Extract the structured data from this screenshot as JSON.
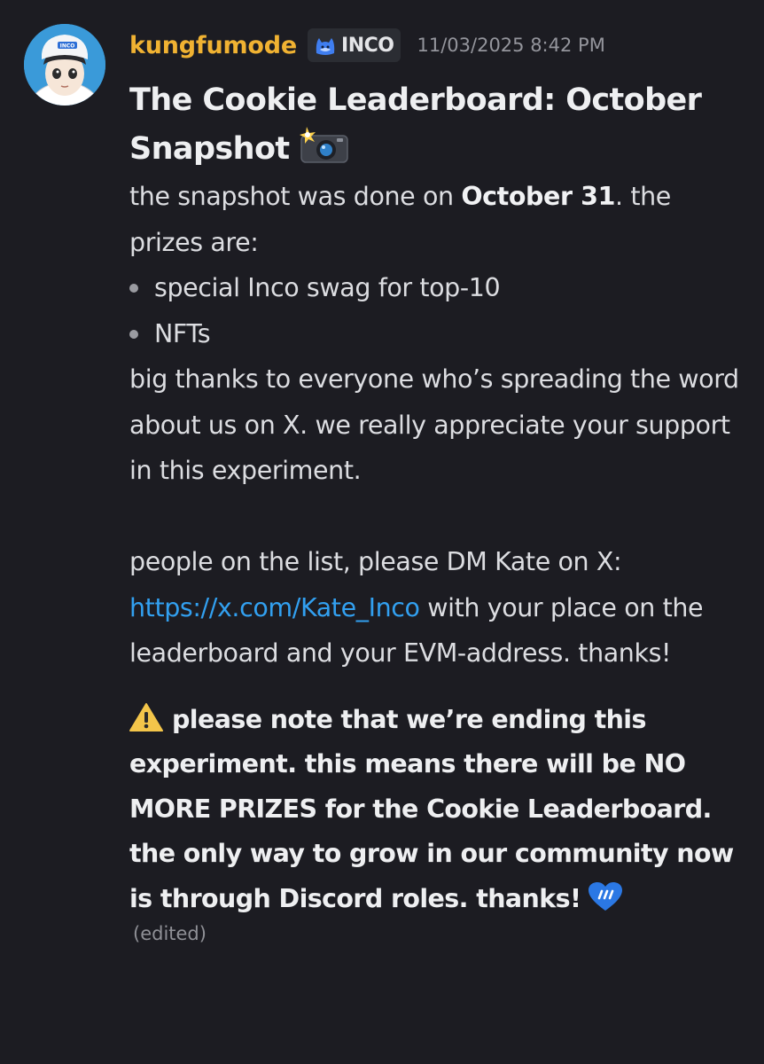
{
  "message": {
    "author": "kungfumode",
    "author_color": "#f0b232",
    "avatar_cap_text": "INCO",
    "server_tag": {
      "icon": "inco-cat-icon",
      "label": "INCO"
    },
    "timestamp": "11/03/2025 8:42 PM",
    "title": "The Cookie Leaderboard: October Snapshot",
    "title_emoji": "camera-with-flash-icon",
    "intro_pre": "the snapshot was done on ",
    "intro_bold": "October 31",
    "intro_post": ". the prizes are:",
    "prizes": [
      "special Inco swag for top-10",
      "NFTs"
    ],
    "thanks_paragraph": "big thanks to everyone who’s spreading the word about us on X. we really appreciate your support in this experiment.",
    "dm_pre": "people on the list, please DM Kate on X: ",
    "dm_link": "https://x.com/Kate_Inco",
    "dm_post": " with your place on the leaderboard and your EVM-address. thanks!",
    "link_color": "#32a0f0",
    "warning_icon": "warning-icon",
    "warning_text": "please note that we’re ending this experiment. this means there will be NO MORE PRIZES for the Cookie Leaderboard. the only way to grow in our community now is through Discord roles. thanks!",
    "heart_icon": "blue-heart-icon",
    "edited_label": "(edited)"
  }
}
